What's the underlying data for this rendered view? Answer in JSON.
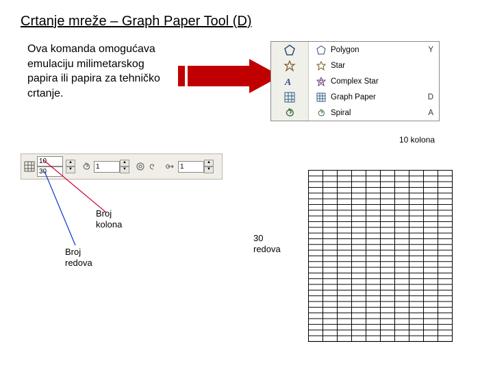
{
  "title": "Crtanje mreže – Graph Paper Tool (D)",
  "paragraph": "Ova komanda omogućava emulaciju milimetarskog papira ili papira za tehničko crtanje.",
  "flyout": {
    "items": [
      {
        "icon": "polygon-icon",
        "label": "Polygon",
        "shortcut": "Y"
      },
      {
        "icon": "star-icon",
        "label": "Star",
        "shortcut": ""
      },
      {
        "icon": "complex-star-icon",
        "label": "Complex Star",
        "shortcut": ""
      },
      {
        "icon": "graph-paper-icon",
        "label": "Graph Paper",
        "shortcut": "D"
      },
      {
        "icon": "spiral-icon",
        "label": "Spiral",
        "shortcut": "A"
      }
    ]
  },
  "kolona_label": "10 kolona",
  "propbar": {
    "columns_value": "10",
    "rows_value": "30",
    "spiral_turns_value": "1",
    "spiral_expand_value": "1"
  },
  "annotations": {
    "broj_kolona": "Broj\nkolona",
    "broj_redova": "Broj\nredova",
    "thirty_redova": "30\nredova"
  },
  "grid": {
    "columns": 10,
    "rows": 30
  }
}
